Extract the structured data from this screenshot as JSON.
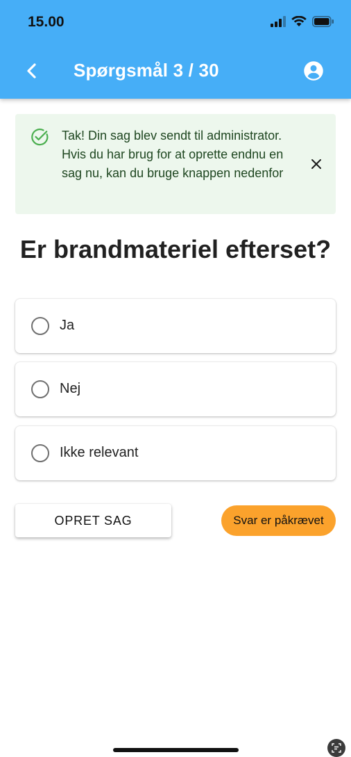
{
  "status_bar": {
    "time": "15.00"
  },
  "app_bar": {
    "title": "Spørgsmål 3 / 30",
    "back_icon": "chevron-left-icon",
    "account_icon": "account-circle-icon",
    "background": "#46aef7"
  },
  "alert": {
    "message": "Tak! Din sag blev sendt til administrator. Hvis du har brug for at oprette endnu en sag nu, kan du bruge knappen nedenfor",
    "icon": "check-circle-outline-icon",
    "close_icon": "close-icon",
    "background": "#edf7ed",
    "icon_color": "#4caf50"
  },
  "question": {
    "text": "Er brandmateriel efterset?"
  },
  "options": [
    {
      "label": "Ja"
    },
    {
      "label": "Nej"
    },
    {
      "label": "Ikke relevant"
    }
  ],
  "actions": {
    "create_case": "OPRET SAG",
    "required": "Svar er påkrævet",
    "required_color": "#fba22c"
  }
}
